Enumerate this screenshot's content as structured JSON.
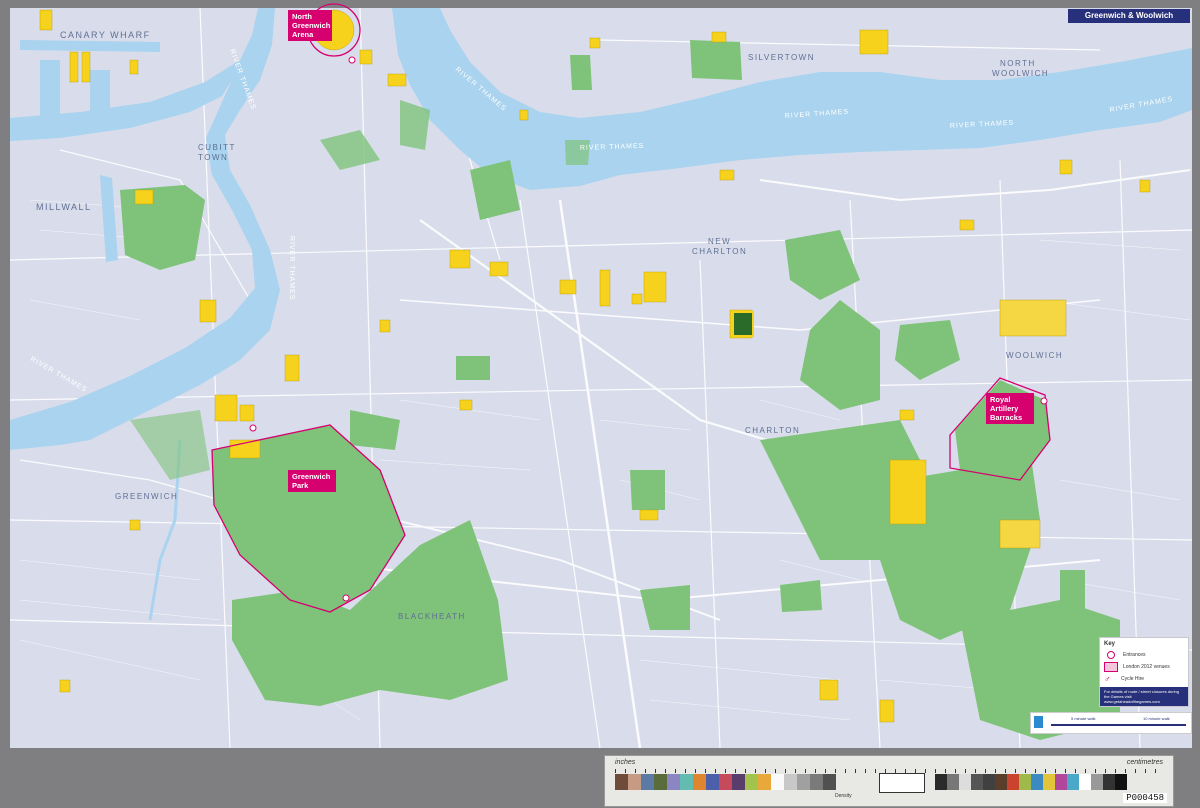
{
  "map": {
    "title": "Greenwich & Woolwich",
    "district_labels": [
      {
        "id": "canary-wharf",
        "text": "CANARY WHARF"
      },
      {
        "id": "silvertown",
        "text": "SILVERTOWN"
      },
      {
        "id": "north-woolwich-1",
        "text": "NORTH"
      },
      {
        "id": "north-woolwich-2",
        "text": "WOOLWICH"
      },
      {
        "id": "cubitt-1",
        "text": "CUBITT"
      },
      {
        "id": "cubitt-2",
        "text": "TOWN"
      },
      {
        "id": "millwall",
        "text": "MILLWALL"
      },
      {
        "id": "new-charlton-1",
        "text": "NEW"
      },
      {
        "id": "new-charlton-2",
        "text": "CHARLTON"
      },
      {
        "id": "woolwich",
        "text": "WOOLWICH"
      },
      {
        "id": "charlton",
        "text": "CHARLTON"
      },
      {
        "id": "greenwich",
        "text": "GREENWICH"
      },
      {
        "id": "blackheath",
        "text": "BLACKHEATH"
      }
    ],
    "river_labels": [
      {
        "id": "r1",
        "text": "RIVER THAMES"
      },
      {
        "id": "r2",
        "text": "RIVER THAMES"
      },
      {
        "id": "r3",
        "text": "RIVER THAMES"
      },
      {
        "id": "r4",
        "text": "RIVER THAMES"
      },
      {
        "id": "r5",
        "text": "RIVER THAMES"
      },
      {
        "id": "r6",
        "text": "RIVER THAMES"
      },
      {
        "id": "r7",
        "text": "RIVER THAMES"
      },
      {
        "id": "r8",
        "text": "RIVER THAMES"
      }
    ],
    "venues": {
      "north_greenwich_arena": "North Greenwich Arena",
      "greenwich_park": "Greenwich Park",
      "royal_artillery_barracks": "Royal Artillery Barracks"
    },
    "colors": {
      "river": "#a9d3ee",
      "land": "#d9ddeb",
      "park": "#7fc37a",
      "building": "#f7d21c",
      "venue": "#d6006f",
      "road": "#ffffff"
    }
  },
  "key": {
    "title": "Key",
    "items": [
      {
        "label": "Entrances",
        "icon": "entrance-icon"
      },
      {
        "label": "London 2012 venues",
        "icon": "venue-boundary-icon"
      },
      {
        "label": "Cycle Hire",
        "icon": "cycle-hire-icon"
      }
    ],
    "note": "For details of route / street closures during the Games visit www.getaheadofthegames.com"
  },
  "scale": {
    "walk_label": "5 minute walk",
    "cycle_label": "10 minute walk"
  },
  "target": {
    "label_left": "inches",
    "label_right": "centimetres",
    "density_label": "Density",
    "code": "P000458"
  }
}
